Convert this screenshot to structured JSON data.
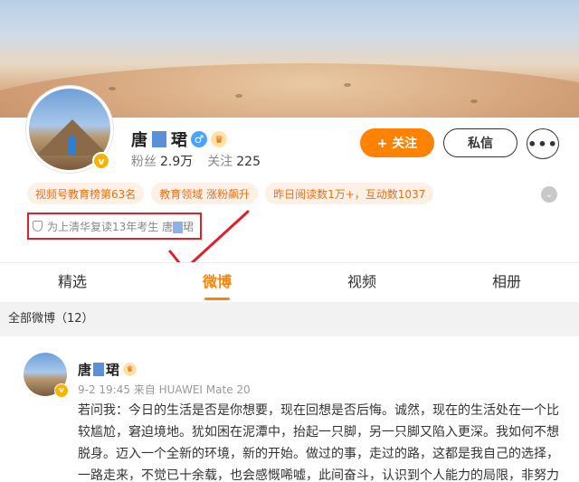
{
  "profile": {
    "name_first": "唐",
    "name_last": "珺",
    "verified_badge": "v",
    "followers_label": "粉丝",
    "followers_value": "2.9万",
    "following_label": "关注",
    "following_value": "225",
    "follow_button": "+ 关注",
    "message_button": "私信",
    "more_button": "•••",
    "tags": [
      "视频号教育榜第63名",
      "教育领域 涨粉飙升",
      "昨日阅读数1万+，互动数1037"
    ],
    "bio_prefix": "为上清华复读13年考生 唐",
    "bio_suffix": "珺",
    "icons": {
      "gender": "male-icon",
      "member": "crown-icon",
      "tags_expand": "chevron-down-icon",
      "bio": "shield-icon"
    }
  },
  "tabs": [
    "精选",
    "微博",
    "视频",
    "相册"
  ],
  "active_tab": "微博",
  "section": {
    "title": "全部微博（12）"
  },
  "post": {
    "name_first": "唐",
    "name_last": "珺",
    "meta": "9-2 19:45  来自 HUAWEI Mate 20",
    "text": "若问我：今日的生活是否是你想要，现在回想是否后悔。诚然，现在的生活处在一个比较尴尬，窘迫境地。犹如困在泥潭中，抬起一只脚，另一只脚又陷入更深。我如何不想脱身。迈入一个全新的环境，新的开始。做过的事，走过的路，这都是我自己的选择，一路走来，不觉已十余载，也会感慨唏嘘，此间奋斗，认识到个人能力的局限，非努力"
  },
  "colors": {
    "accent": "#ff8200",
    "annotation": "#e0202a",
    "tag_bg": "#fdf0e4",
    "tag_text": "#e8711a"
  }
}
